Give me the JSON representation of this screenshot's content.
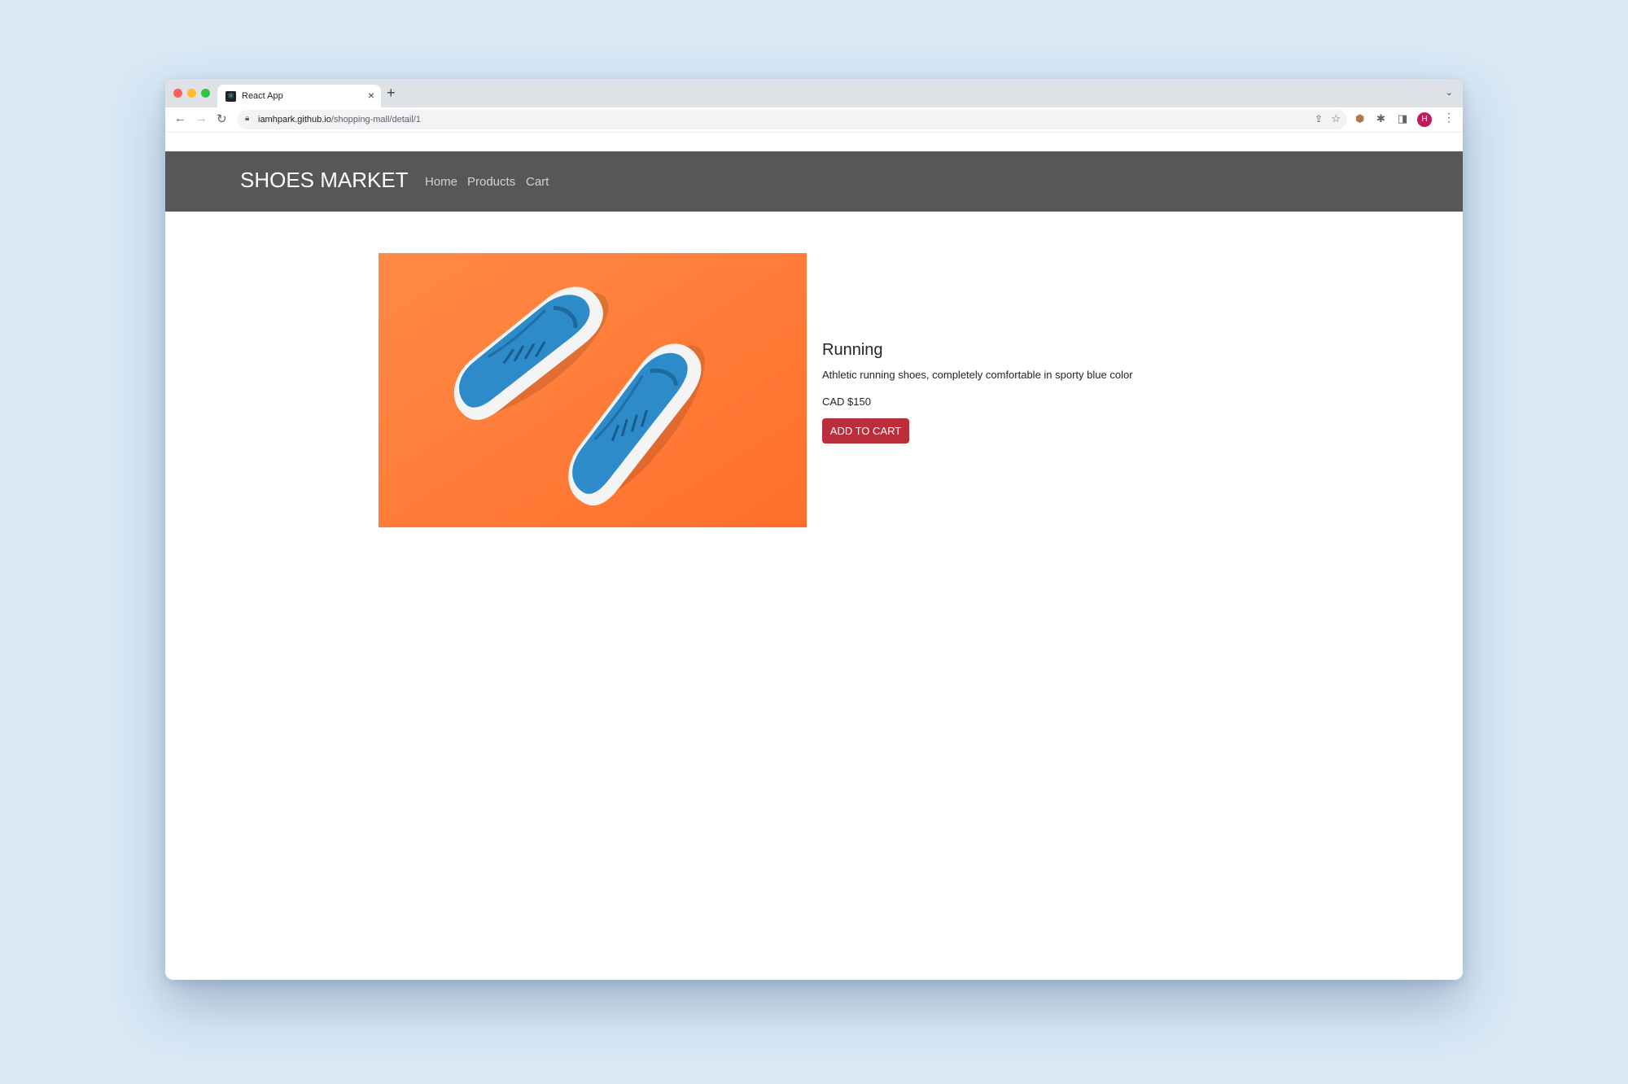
{
  "browser": {
    "tab_title": "React App",
    "tab_close": "×",
    "new_tab": "+",
    "tab_menu": "⌄",
    "url_host": "iamhpark.github.io",
    "url_path": "/shopping-mall/detail/1",
    "avatar_initial": "H"
  },
  "navbar": {
    "brand": "SHOES MARKET",
    "links": [
      "Home",
      "Products",
      "Cart"
    ]
  },
  "product": {
    "name": "Running",
    "description": "Athletic running shoes, completely comfortable in sporty blue color",
    "price": "CAD $150",
    "add_to_cart_label": "ADD TO CART",
    "image_icon": "blue-running-shoes-image"
  },
  "colors": {
    "navbar_bg": "#575757",
    "button_bg": "#bb2d3b",
    "image_bg": "#ff7a35",
    "shoe_blue": "#2e8bc9"
  }
}
